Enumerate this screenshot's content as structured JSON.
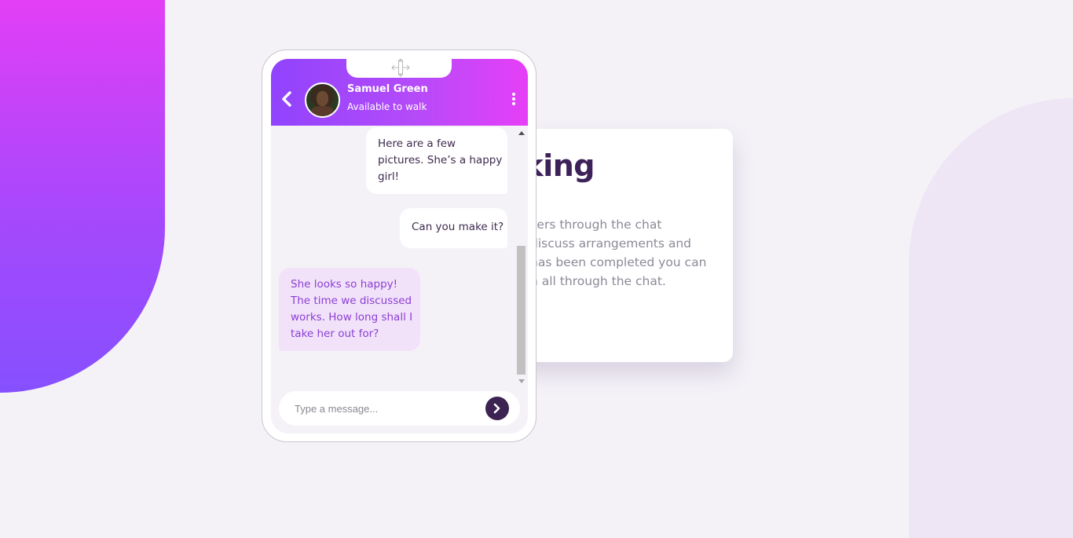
{
  "contact": {
    "name": "Samuel Green",
    "status": "Available to walk"
  },
  "messages": {
    "out1": [
      "Here are a few",
      "pictures. She’s a happy",
      "girl!"
    ],
    "out2": "Can you make it?",
    "in1": [
      "She looks so happy!",
      "The time we discussed",
      "works. How long shall I",
      "take her out for?"
    ]
  },
  "composer": {
    "placeholder": "Type a message..."
  },
  "info": {
    "title": "king",
    "lines": [
      "kers through the chat",
      "discuss arrangements and",
      "has been completed you can",
      "n all through the chat."
    ]
  },
  "icons": {
    "back": "chevron-left-icon",
    "menu": "kebab-menu-icon",
    "send": "chevron-right-icon",
    "move": "move-arrows-icon"
  },
  "colors": {
    "accent_start": "#9043fd",
    "accent_end": "#e63ff7",
    "dark_purple": "#3c2352",
    "incoming_bubble": "#f2e2f9"
  }
}
